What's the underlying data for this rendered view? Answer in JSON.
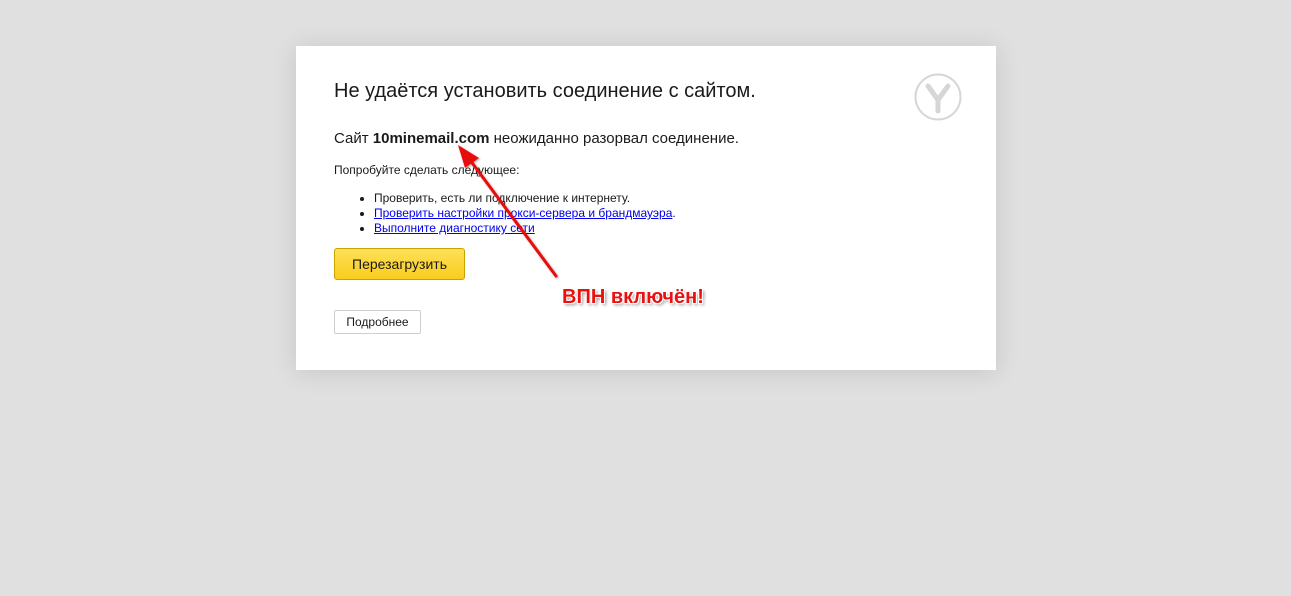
{
  "page": {
    "title": "Не удаётся установить соединение с сайтом.",
    "message": {
      "prefix": "Сайт ",
      "domain": "10minemail.com",
      "suffix": " неожиданно разорвал соединение."
    },
    "hint": "Попробуйте сделать следующее:",
    "suggestions": [
      {
        "text": "Проверить, есть ли подключение к интернету.",
        "link": false
      },
      {
        "text": "Проверить настройки прокси-сервера и брандмауэра",
        "link": true,
        "trailing": "."
      },
      {
        "text": "Выполните диагностику сети",
        "link": true,
        "trailing": ""
      }
    ],
    "reload_label": "Перезагрузить",
    "details_label": "Подробнее"
  },
  "annotation": {
    "text": "ВПН включён!",
    "color": "#e8110f"
  },
  "colors": {
    "background": "#e0e0e0",
    "card": "#ffffff",
    "button_yellow": "#ffdb4d",
    "link": "#0000ee"
  },
  "icons": {
    "browser_logo": "yandex-browser-logo-icon"
  }
}
